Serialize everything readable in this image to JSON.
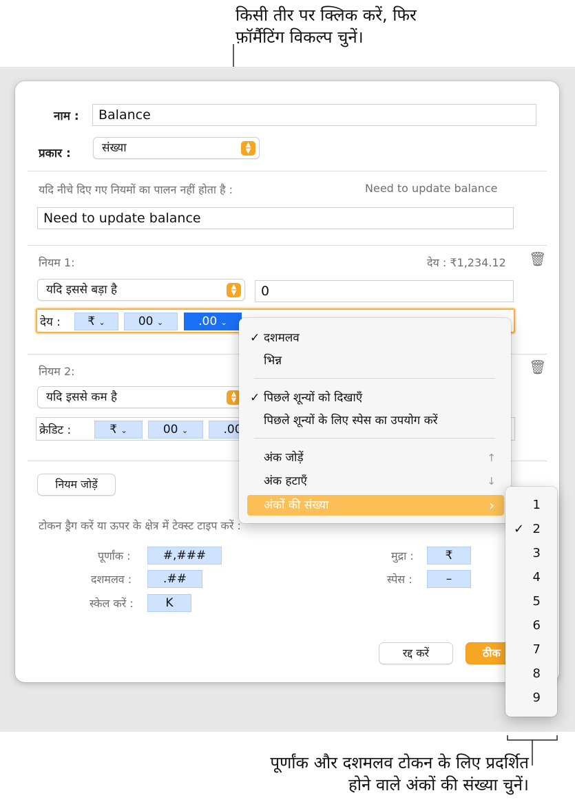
{
  "callouts": {
    "top_line1": "किसी तीर पर क्लिक करें, फिर",
    "top_line2": "फ़ॉर्मैटिंग विकल्प चुनें।",
    "bottom_line1": "पूर्णांक और दशमलव टोकन के लिए प्रदर्शित",
    "bottom_line2": "होने वाले अंकों की संख्या चुनें।"
  },
  "dialog": {
    "name_label": "नाम :",
    "name_value": "Balance",
    "type_label": "प्रकार :",
    "type_value": "संख्या",
    "rules_condition_text": "यदि नीचे दिए गए नियमों का पालन नहीं होता है :",
    "rules_preview": "Need to update balance",
    "rules_value": "Need to update balance",
    "rule1": {
      "title": "नियम 1:",
      "preview": "देय : ₹1,234.12",
      "condition": "यदि इससे बड़ा है",
      "value": "0",
      "prefix": "देय :",
      "token_currency": "₹",
      "token_integer": "00",
      "token_decimal": ".00"
    },
    "rule2": {
      "title": "नियम 2:",
      "condition": "यदि इससे कम है",
      "prefix": "क्रेडिट :",
      "token_currency": "₹",
      "token_integer": "00",
      "token_decimal": ".00"
    },
    "add_rule_button": "नियम जोड़ें",
    "token_hint": "टोकन ड्रैग करें या ऊपर के क्षेत्र में टेक्स्ट टाइप करें :",
    "tokens": {
      "integer_label": "पूर्णांक :",
      "integer_token": "#,###",
      "decimal_label": "दशमलव :",
      "decimal_token": ".##",
      "scale_label": "स्केल करें :",
      "scale_token": "K",
      "currency_label": "मुद्रा :",
      "currency_token": "₹",
      "space_label": "स्पेस :",
      "space_token": "–"
    },
    "cancel_button": "रद्द करें",
    "ok_button": "ठीक"
  },
  "menu": {
    "decimal": "दशमलव",
    "fraction": "भिन्न",
    "show_trailing_zeros": "पिछले शून्यों को दिखाएँ",
    "space_trailing_zeros": "पिछले शून्यों के लिए स्पेस का उपयोग करें",
    "add_digit": "अंक जोड़ें",
    "add_digit_key": "↑",
    "remove_digit": "अंक हटाएँ",
    "remove_digit_key": "↓",
    "digit_count": "अंकों की संख्या",
    "check": "✓",
    "chevron": "›"
  },
  "submenu": {
    "items": [
      "1",
      "2",
      "3",
      "4",
      "5",
      "6",
      "7",
      "8",
      "9"
    ],
    "selected": "2"
  },
  "colors": {
    "accent_orange": "#f6a623",
    "token_blue": "#cfe3ff",
    "selected_blue": "#1a6ff5"
  }
}
